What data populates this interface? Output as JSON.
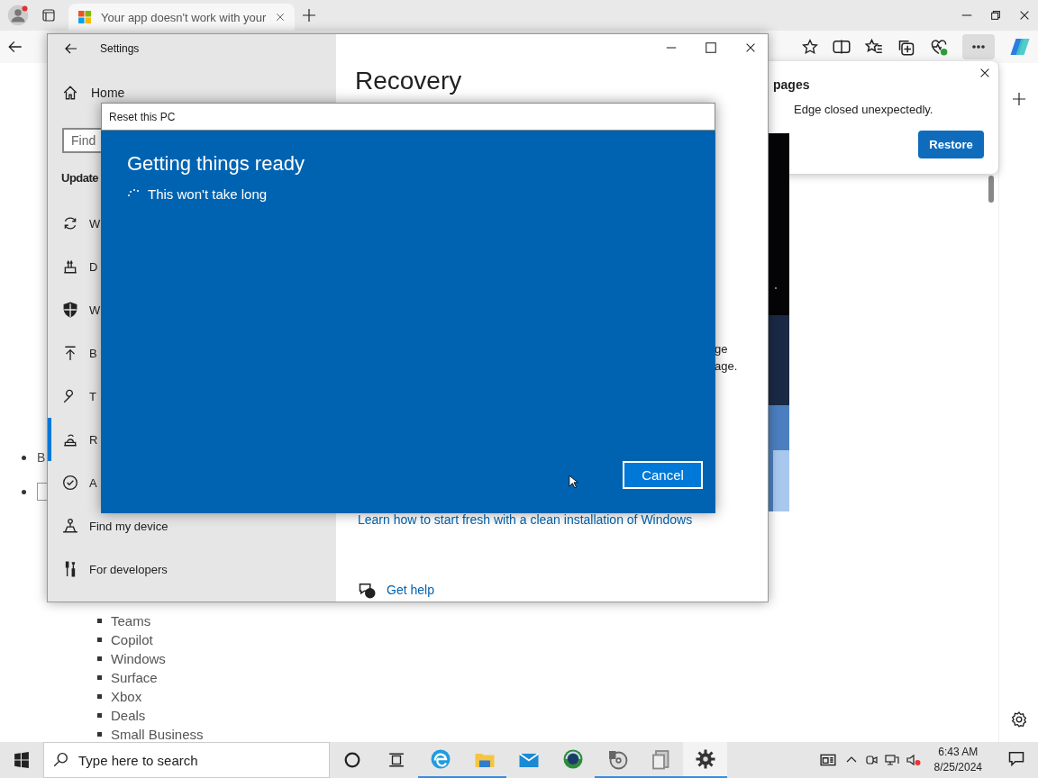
{
  "browser": {
    "tabs": [
      {
        "title": "Your app doesn't work with your",
        "selected": true
      }
    ],
    "restore_popup": {
      "title": "pages",
      "message": "Edge closed unexpectedly.",
      "button": "Restore"
    },
    "upper_items": [
      {
        "kind": "text",
        "label": "B"
      },
      {
        "kind": "box",
        "checked": false
      }
    ],
    "page_list": [
      "Teams",
      "Copilot",
      "Windows",
      "Surface",
      "Xbox",
      "Deals",
      "Small Business"
    ]
  },
  "settings": {
    "title": "Settings",
    "home": "Home",
    "search_placeholder": "Find",
    "section": "Update",
    "nav": [
      {
        "label": "W",
        "selected": false
      },
      {
        "label": "D",
        "selected": false
      },
      {
        "label": "W",
        "selected": false
      },
      {
        "label": "B",
        "selected": false
      },
      {
        "label": "T",
        "selected": false
      },
      {
        "label": "R",
        "selected": true
      },
      {
        "label": "A",
        "selected": false
      },
      {
        "label": "Find my device",
        "selected": false
      },
      {
        "label": "For developers",
        "selected": false
      }
    ],
    "page_title": "Recovery",
    "text_fragments": [
      "ge",
      "age."
    ],
    "link": "Learn how to start fresh with a clean installation of Windows",
    "help": "Get help"
  },
  "dialog": {
    "title": "Reset this PC",
    "heading": "Getting things ready",
    "status": "This won't take long",
    "button": "Cancel"
  },
  "taskbar": {
    "search_placeholder": "Type here to search",
    "apps": [
      {
        "kind": "edge",
        "running": true,
        "selected": false
      },
      {
        "kind": "folder",
        "running": true,
        "selected": false
      },
      {
        "kind": "mail",
        "running": false,
        "selected": false
      },
      {
        "kind": "globe",
        "running": false,
        "selected": false
      },
      {
        "kind": "disc",
        "running": true,
        "selected": false
      },
      {
        "kind": "files",
        "running": true,
        "selected": false
      },
      {
        "kind": "gear",
        "running": true,
        "selected": true
      }
    ],
    "time": "6:43 AM",
    "date": "8/25/2024"
  }
}
